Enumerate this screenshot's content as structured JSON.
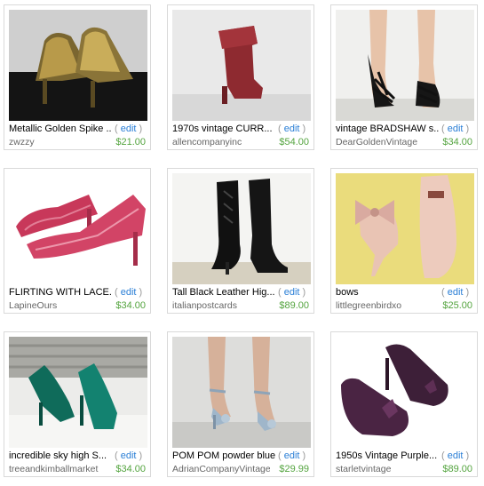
{
  "listings": [
    {
      "title": "Metallic Golden Spike ...",
      "edit_label": "edit",
      "seller": "zwzzy",
      "price": "$21.00",
      "image_icon": "gold-heels-image"
    },
    {
      "title": "1970s vintage CURR...",
      "edit_label": "edit",
      "seller": "allencompanyinc",
      "price": "$54.00",
      "image_icon": "red-suede-boot-image"
    },
    {
      "title": "vintage BRADSHAW s...",
      "edit_label": "edit",
      "seller": "DearGoldenVintage",
      "price": "$34.00",
      "image_icon": "black-strappy-sandals-image"
    },
    {
      "title": "FLIRTING WITH LACE...",
      "edit_label": "edit",
      "seller": "LapineOurs",
      "price": "$34.00",
      "image_icon": "pink-lace-pumps-image"
    },
    {
      "title": "Tall Black Leather Hig...",
      "edit_label": "edit",
      "seller": "italianpostcards",
      "price": "$89.00",
      "image_icon": "black-leather-boots-image"
    },
    {
      "title": "bows",
      "edit_label": "edit",
      "seller": "littlegreenbirdxo",
      "price": "$25.00",
      "image_icon": "nude-bow-pumps-image"
    },
    {
      "title": "incredible sky high S...",
      "edit_label": "edit",
      "seller": "treeandkimballmarket",
      "price": "$34.00",
      "image_icon": "green-pumps-image"
    },
    {
      "title": "POM POM powder blue...",
      "edit_label": "edit",
      "seller": "AdrianCompanyVintage",
      "price": "$29.99",
      "image_icon": "powder-blue-sandals-image"
    },
    {
      "title": "1950s Vintage Purple...",
      "edit_label": "edit",
      "seller": "starletvintage",
      "price": "$89.00",
      "image_icon": "purple-bow-pumps-image"
    }
  ],
  "colors": {
    "price": "#54a43f",
    "edit_link": "#2b7fd6",
    "seller": "#666666",
    "border": "#d9d9d9"
  }
}
